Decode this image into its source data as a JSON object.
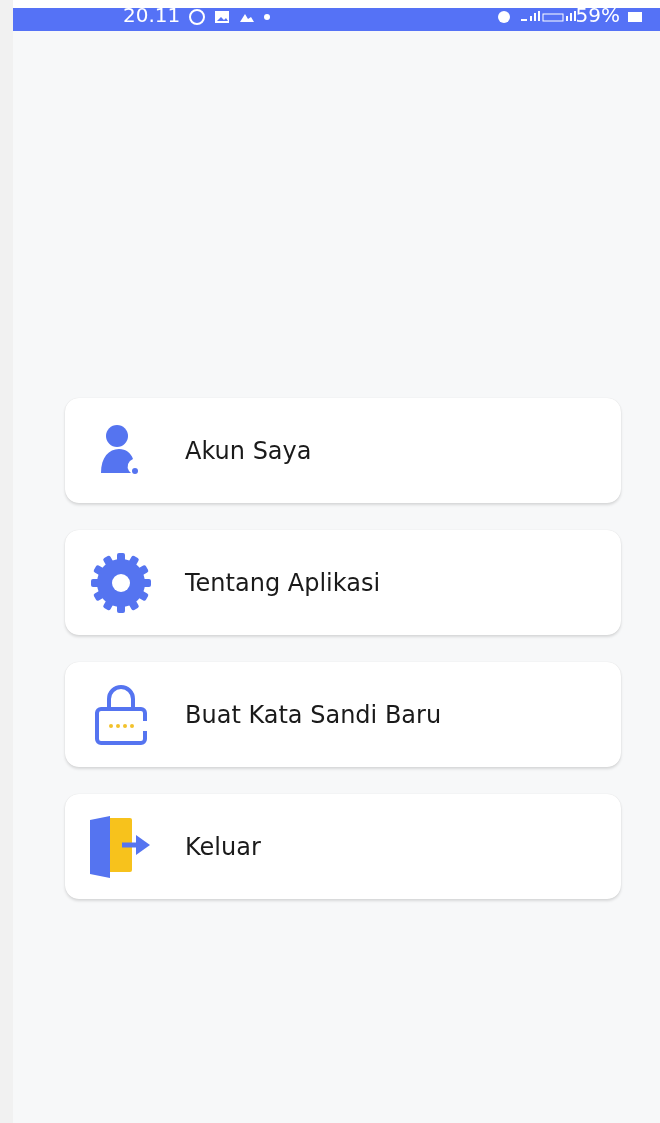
{
  "status_bar": {
    "time": "20.11",
    "battery": "59%"
  },
  "menu": [
    {
      "label": "Akun Saya"
    },
    {
      "label": "Tentang Aplikasi"
    },
    {
      "label": "Buat Kata Sandi Baru"
    },
    {
      "label": "Keluar"
    }
  ]
}
